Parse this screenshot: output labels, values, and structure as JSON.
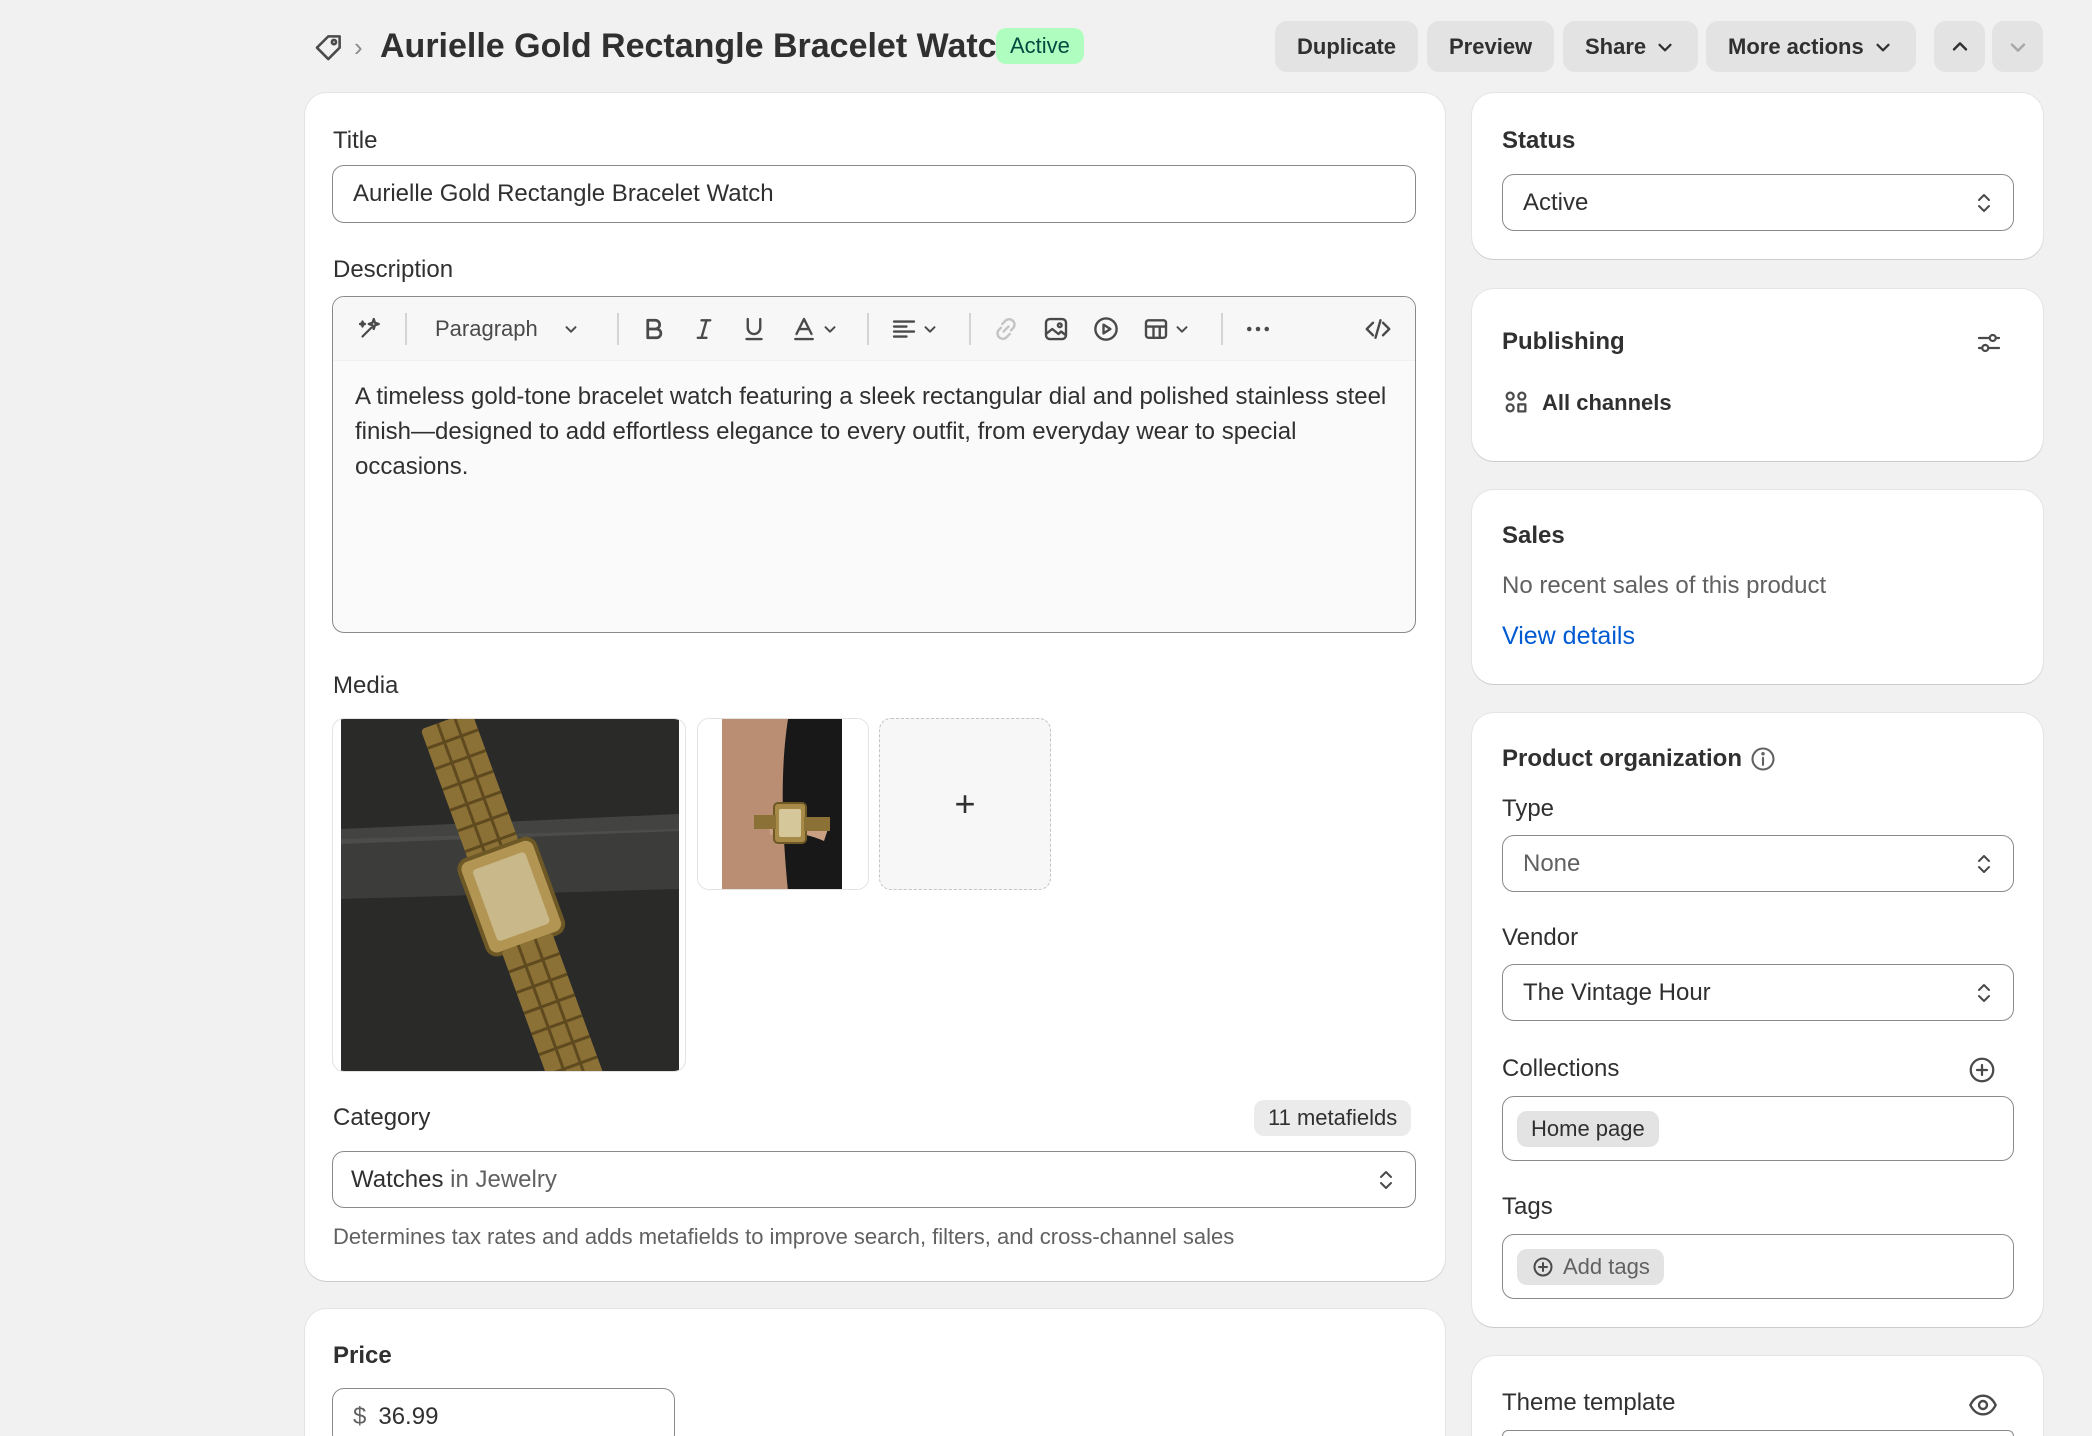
{
  "header": {
    "title": "Aurielle Gold Rectangle Bracelet Watch",
    "status_badge": "Active",
    "buttons": {
      "duplicate": "Duplicate",
      "preview": "Preview",
      "share": "Share",
      "more_actions": "More actions"
    }
  },
  "main": {
    "title_label": "Title",
    "title_value": "Aurielle Gold Rectangle Bracelet Watch",
    "description_label": "Description",
    "editor": {
      "paragraph_select": "Paragraph",
      "content": "A timeless gold-tone bracelet watch featuring a sleek rectangular dial and polished stainless steel finish—designed to add effortless elegance to every outfit, from everyday wear to special occasions."
    },
    "media_label": "Media",
    "media_add": "+",
    "category_label": "Category",
    "metafields_badge": "11 metafields",
    "category_value": "Watches",
    "category_in": " in Jewelry",
    "category_help": "Determines tax rates and adds metafields to improve search, filters, and cross-channel sales"
  },
  "price": {
    "label": "Price",
    "currency": "$",
    "value": "36.99"
  },
  "sidebar": {
    "status": {
      "label": "Status",
      "value": "Active"
    },
    "publishing": {
      "label": "Publishing",
      "channels": "All channels"
    },
    "sales": {
      "label": "Sales",
      "text": "No recent sales of this product",
      "link": "View details"
    },
    "organization": {
      "label": "Product organization",
      "type_label": "Type",
      "type_value": "None",
      "vendor_label": "Vendor",
      "vendor_value": "The Vintage Hour",
      "collections_label": "Collections",
      "collection_pill": "Home page",
      "tags_label": "Tags",
      "add_tags": "Add tags"
    },
    "theme_template": {
      "label": "Theme template"
    }
  },
  "colors": {
    "page_bg": "#f1f1f1",
    "badge_bg": "#affebf",
    "badge_text": "#014b40",
    "link": "#005bd3"
  }
}
